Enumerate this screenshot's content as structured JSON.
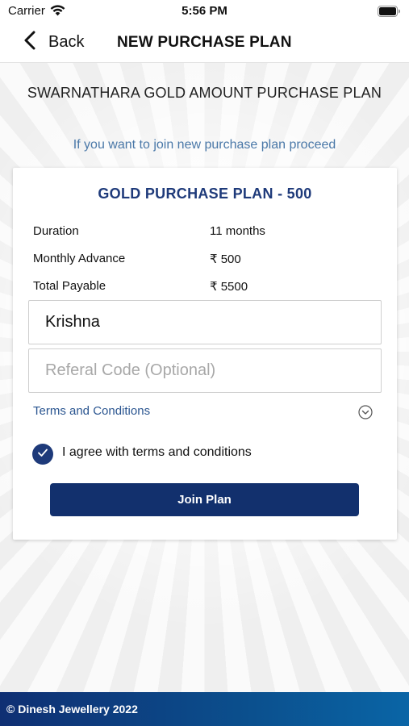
{
  "status_bar": {
    "carrier": "Carrier",
    "time": "5:56 PM",
    "wifi_icon": "wifi-icon",
    "battery_icon": "battery-icon"
  },
  "nav": {
    "back_label": "Back",
    "back_icon": "chevron-left-icon",
    "title": "NEW PURCHASE PLAN"
  },
  "main": {
    "heading": "SWARNATHARA GOLD AMOUNT PURCHASE PLAN",
    "proceed_text": "If you want to join new purchase plan proceed"
  },
  "plan": {
    "title": "GOLD PURCHASE PLAN - 500",
    "details": [
      {
        "label": "Duration",
        "value": "11 months"
      },
      {
        "label": "Monthly Advance",
        "value": "₹ 500"
      },
      {
        "label": "Total Payable",
        "value": "₹ 5500"
      }
    ],
    "name_value": "Krishna",
    "referral_placeholder": "Referal Code (Optional)",
    "terms_label": "Terms and Conditions",
    "terms_icon": "chevron-down-circle-icon",
    "agree_checked": true,
    "agree_label": "I agree with terms and conditions",
    "join_label": "Join Plan"
  },
  "footer": {
    "text": "© Dinesh Jewellery 2022"
  },
  "colors": {
    "primary": "#12306d",
    "plan_title": "#1e3a7a",
    "link": "#2a5590",
    "proceed_text": "#4a78a8"
  }
}
